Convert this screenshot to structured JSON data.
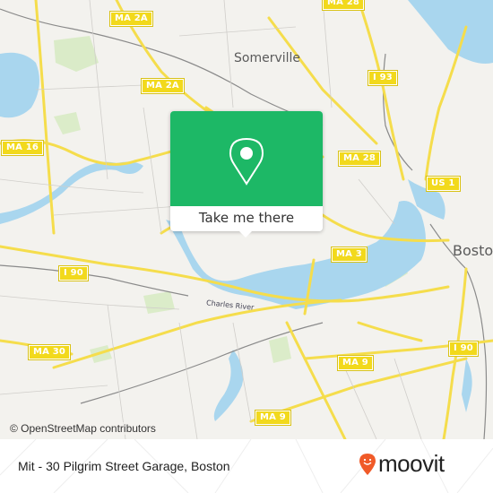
{
  "map": {
    "attribution": "© OpenStreetMap contributors",
    "places": [
      {
        "id": "somerville",
        "name": "Somerville"
      },
      {
        "id": "boston",
        "name": "Bosto"
      }
    ],
    "river_label": "Charles River",
    "road_shields": [
      {
        "id": "ma2a-top",
        "label": "MA 2A"
      },
      {
        "id": "ma2a-mid",
        "label": "MA 2A"
      },
      {
        "id": "ma16",
        "label": "MA 16"
      },
      {
        "id": "ma28-top",
        "label": "MA 28"
      },
      {
        "id": "i93",
        "label": "I 93"
      },
      {
        "id": "ma28",
        "label": "MA 28"
      },
      {
        "id": "us1",
        "label": "US 1"
      },
      {
        "id": "i90-left",
        "label": "I 90"
      },
      {
        "id": "ma3",
        "label": "MA 3"
      },
      {
        "id": "ma30",
        "label": "MA 30"
      },
      {
        "id": "ma9-mid",
        "label": "MA 9"
      },
      {
        "id": "i90-right",
        "label": "I 90"
      },
      {
        "id": "ma9-bottom",
        "label": "MA 9"
      }
    ],
    "colors": {
      "land": "#f3f2ee",
      "water": "#a9d6ee",
      "road": "#f5dd4c",
      "park": "#d8ebc4",
      "rail": "#8a8a8a"
    }
  },
  "popup": {
    "icon": "map-pin-icon",
    "button_label": "Take me there",
    "color": "#1db866"
  },
  "footer": {
    "place_name": "Mit - 30 Pilgrim Street Garage, Boston",
    "logo_text": "moovit",
    "logo_color": "#f05a28"
  }
}
